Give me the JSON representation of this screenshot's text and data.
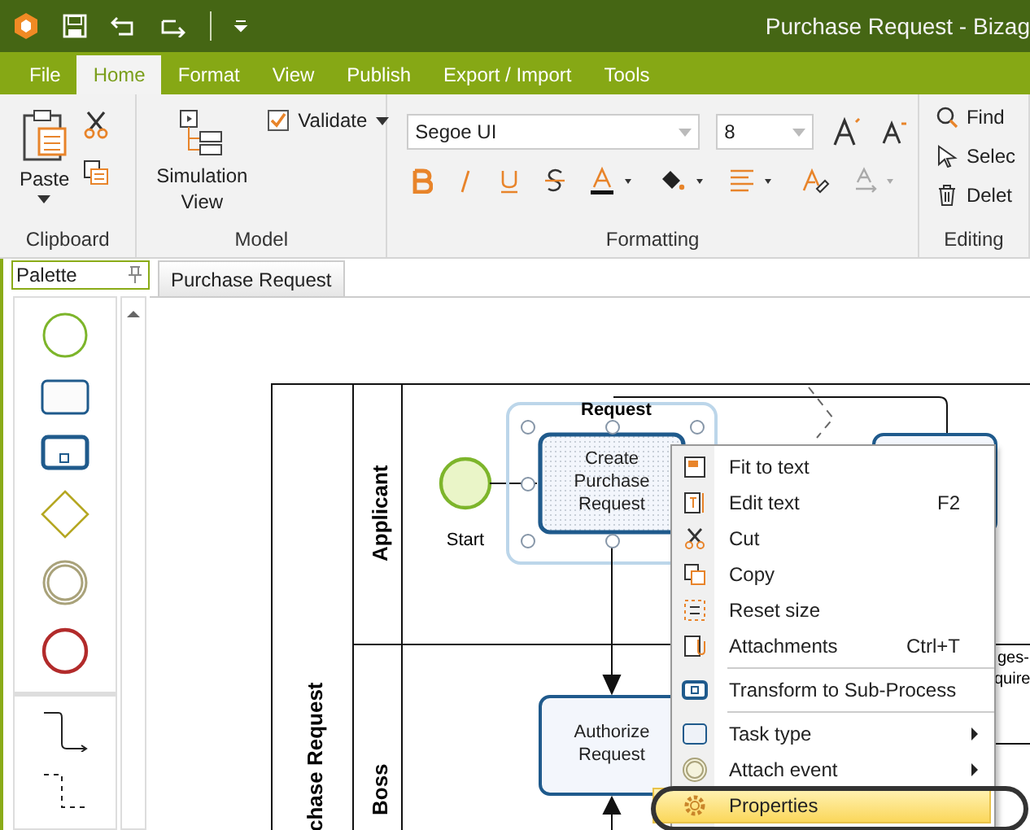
{
  "title_bar": {
    "title": "Purchase Request - Bizag"
  },
  "ribbon_tabs": [
    {
      "label": "File",
      "selected": false
    },
    {
      "label": "Home",
      "selected": true
    },
    {
      "label": "Format",
      "selected": false
    },
    {
      "label": "View",
      "selected": false
    },
    {
      "label": "Publish",
      "selected": false
    },
    {
      "label": "Export / Import",
      "selected": false
    },
    {
      "label": "Tools",
      "selected": false
    }
  ],
  "ribbon": {
    "clipboard": {
      "label": "Clipboard",
      "paste": "Paste"
    },
    "model": {
      "label": "Model",
      "simulation": "Simulation View",
      "validate": {
        "label": "Validate",
        "checked": true
      }
    },
    "formatting": {
      "label": "Formatting",
      "font": "Segoe UI",
      "size": "8"
    },
    "editing": {
      "label": "Editing",
      "find": "Find",
      "select": "Selec",
      "delete": "Delet"
    }
  },
  "palette": {
    "title": "Palette"
  },
  "document_tab": {
    "label": "Purchase Request",
    "selected": true
  },
  "diagram": {
    "pool": "chase Request",
    "lanes": [
      "Applicant",
      "Boss"
    ],
    "start": "Start",
    "group_label": "Request",
    "tasks": [
      {
        "label": "Create Purchase Request",
        "selected": true
      },
      {
        "label": "Authorize Request",
        "selected": false
      }
    ],
    "partial_texts": [
      "ges-",
      "quire"
    ]
  },
  "context_menu": [
    {
      "kind": "item",
      "label": "Fit to text",
      "submenu": false,
      "selected": false
    },
    {
      "kind": "item",
      "label": "Edit text",
      "shortcut": "F2",
      "submenu": false,
      "selected": false
    },
    {
      "kind": "item",
      "label": "Cut",
      "submenu": false,
      "selected": false
    },
    {
      "kind": "item",
      "label": "Copy",
      "submenu": false,
      "selected": false
    },
    {
      "kind": "item",
      "label": "Reset size",
      "submenu": false,
      "selected": false
    },
    {
      "kind": "item",
      "label": "Attachments",
      "shortcut": "Ctrl+T",
      "submenu": false,
      "selected": false
    },
    {
      "kind": "separator"
    },
    {
      "kind": "item",
      "label": "Transform to Sub-Process",
      "submenu": false,
      "selected": false
    },
    {
      "kind": "separator"
    },
    {
      "kind": "item",
      "label": "Task type",
      "submenu": true,
      "selected": false
    },
    {
      "kind": "item",
      "label": "Attach event",
      "submenu": true,
      "selected": false
    },
    {
      "kind": "item",
      "label": "Properties",
      "submenu": false,
      "selected": true
    }
  ]
}
